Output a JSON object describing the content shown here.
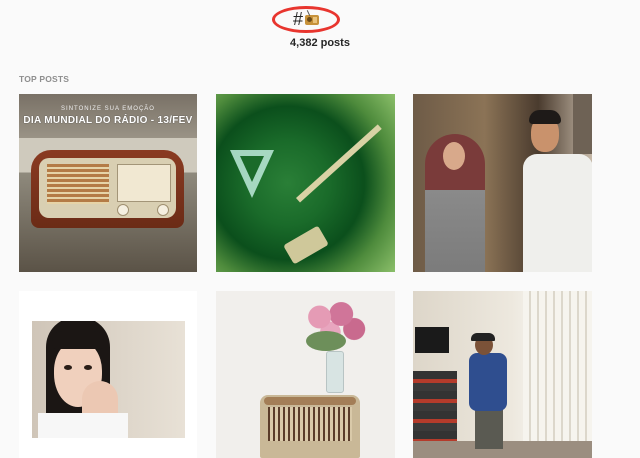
{
  "header": {
    "hashtag_symbol": "#",
    "hashtag_emoji": "radio-emoji",
    "post_count": "4,382 posts"
  },
  "sections": {
    "top_posts_label": "TOP POSTS"
  },
  "posts": [
    {
      "kind": "radio-poster",
      "line1": "SINTONIZE SUA EMOÇÃO",
      "line2": "DIA MUNDIAL DO RÁDIO - 13/FEV"
    },
    {
      "kind": "vinyl-record"
    },
    {
      "kind": "two-people-scene"
    },
    {
      "kind": "girl-selfie"
    },
    {
      "kind": "flowers-and-radio"
    },
    {
      "kind": "man-dancing-room"
    }
  ],
  "colors": {
    "highlight_circle": "#e8352e",
    "background": "#fafafa",
    "muted_text": "#8e8e8e"
  }
}
